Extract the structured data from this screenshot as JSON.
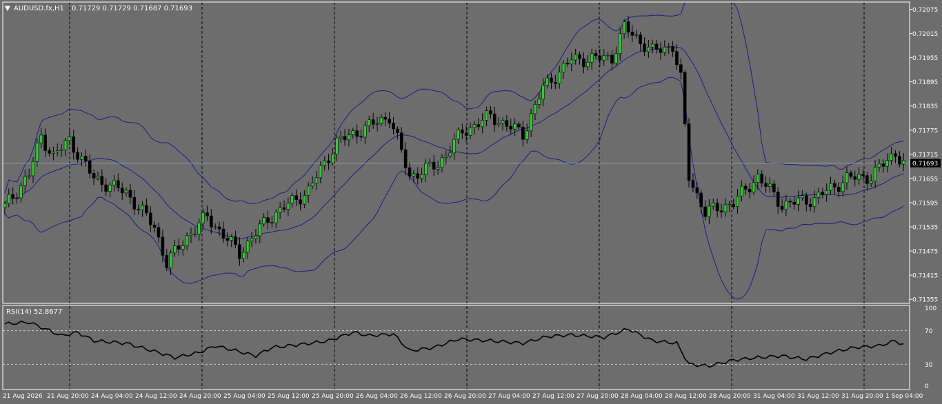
{
  "colors": {
    "background": "#6d6d6d",
    "frame": "#ffffff",
    "grid": "#000000",
    "bull_body": "#27d327",
    "bear_body": "#000000",
    "wick": "#000000",
    "bands": "#1a1a8c",
    "rsi_line": "#000000",
    "current_price_line": "#8fa3b8",
    "price_box_bg": "#000000",
    "price_box_text": "#ffffff"
  },
  "header": {
    "symbol_tf": "AUDUSD.fx,H1",
    "ohlc": "0.71729 0.71729 0.71687 0.71693",
    "dropdown_icon": "triangle-down-icon"
  },
  "rsi_header": {
    "label": "RSI(14) 52.8677"
  },
  "chart_data": [
    {
      "type": "candlestick",
      "symbol": "AUDUSD.fx",
      "timeframe": "H1",
      "y_ticks": [
        "0.72075",
        "0.72015",
        "0.71955",
        "0.71895",
        "0.71835",
        "0.71775",
        "0.71715",
        "0.71655",
        "0.71595",
        "0.71535",
        "0.71475",
        "0.71415",
        "0.71355"
      ],
      "ylim": [
        0.71345,
        0.72093
      ],
      "current_price": "0.71693",
      "grid": "vertical dashed at date ticks",
      "x_labels": [
        "21 Aug 2026",
        "21 Aug 20:00",
        "24 Aug 04:00",
        "24 Aug 12:00",
        "24 Aug 20:00",
        "25 Aug 04:00",
        "25 Aug 12:00",
        "25 Aug 20:00",
        "26 Aug 04:00",
        "26 Aug 12:00",
        "26 Aug 20:00",
        "27 Aug 04:00",
        "27 Aug 12:00",
        "27 Aug 20:00",
        "28 Aug 04:00",
        "28 Aug 12:00",
        "28 Aug 20:00",
        "31 Aug 04:00",
        "31 Aug 12:00",
        "31 Aug 20:00",
        "1 Sep 04:00"
      ],
      "ohlc_anchor_points": [
        {
          "i": 0,
          "close": 0.71585
        },
        {
          "i": 6,
          "close": 0.71665
        },
        {
          "i": 9,
          "close": 0.7176
        },
        {
          "i": 12,
          "close": 0.7171
        },
        {
          "i": 16,
          "close": 0.7175
        },
        {
          "i": 22,
          "close": 0.71655
        },
        {
          "i": 30,
          "close": 0.7162
        },
        {
          "i": 37,
          "close": 0.71535
        },
        {
          "i": 40,
          "close": 0.71445
        },
        {
          "i": 45,
          "close": 0.7151
        },
        {
          "i": 50,
          "close": 0.7156
        },
        {
          "i": 58,
          "close": 0.7147
        },
        {
          "i": 65,
          "close": 0.71555
        },
        {
          "i": 75,
          "close": 0.71625
        },
        {
          "i": 82,
          "close": 0.71745
        },
        {
          "i": 89,
          "close": 0.7178
        },
        {
          "i": 95,
          "close": 0.7181
        },
        {
          "i": 100,
          "close": 0.7166
        },
        {
          "i": 107,
          "close": 0.7169
        },
        {
          "i": 113,
          "close": 0.7177
        },
        {
          "i": 120,
          "close": 0.7181
        },
        {
          "i": 128,
          "close": 0.71765
        },
        {
          "i": 133,
          "close": 0.7188
        },
        {
          "i": 140,
          "close": 0.7195
        },
        {
          "i": 150,
          "close": 0.71955
        },
        {
          "i": 153,
          "close": 0.7203
        },
        {
          "i": 160,
          "close": 0.7197
        },
        {
          "i": 165,
          "close": 0.71985
        },
        {
          "i": 167,
          "close": 0.719
        },
        {
          "i": 169,
          "close": 0.7166
        },
        {
          "i": 173,
          "close": 0.7157
        },
        {
          "i": 180,
          "close": 0.71595
        },
        {
          "i": 186,
          "close": 0.7166
        },
        {
          "i": 192,
          "close": 0.7159
        },
        {
          "i": 200,
          "close": 0.71605
        },
        {
          "i": 208,
          "close": 0.71655
        },
        {
          "i": 214,
          "close": 0.7166
        },
        {
          "i": 220,
          "close": 0.7172
        },
        {
          "i": 222,
          "close": 0.71693
        }
      ],
      "bollinger_period_visible": true
    },
    {
      "type": "line",
      "name": "RSI(14) 52.8677",
      "ylim": [
        0,
        100
      ],
      "y_ticks": [
        "100",
        "70",
        "30",
        "0"
      ],
      "levels": [
        70,
        30
      ],
      "rsi_anchor_points": [
        {
          "i": 0,
          "v": 78
        },
        {
          "i": 6,
          "v": 80
        },
        {
          "i": 9,
          "v": 74
        },
        {
          "i": 14,
          "v": 64
        },
        {
          "i": 18,
          "v": 68
        },
        {
          "i": 22,
          "v": 58
        },
        {
          "i": 30,
          "v": 55
        },
        {
          "i": 38,
          "v": 44
        },
        {
          "i": 42,
          "v": 38
        },
        {
          "i": 48,
          "v": 44
        },
        {
          "i": 52,
          "v": 52
        },
        {
          "i": 58,
          "v": 45
        },
        {
          "i": 62,
          "v": 40
        },
        {
          "i": 66,
          "v": 50
        },
        {
          "i": 74,
          "v": 54
        },
        {
          "i": 80,
          "v": 58
        },
        {
          "i": 86,
          "v": 68
        },
        {
          "i": 90,
          "v": 64
        },
        {
          "i": 96,
          "v": 66
        },
        {
          "i": 100,
          "v": 46
        },
        {
          "i": 106,
          "v": 50
        },
        {
          "i": 112,
          "v": 60
        },
        {
          "i": 120,
          "v": 58
        },
        {
          "i": 128,
          "v": 55
        },
        {
          "i": 134,
          "v": 63
        },
        {
          "i": 140,
          "v": 65
        },
        {
          "i": 148,
          "v": 62
        },
        {
          "i": 154,
          "v": 72
        },
        {
          "i": 160,
          "v": 58
        },
        {
          "i": 166,
          "v": 55
        },
        {
          "i": 169,
          "v": 30
        },
        {
          "i": 174,
          "v": 28
        },
        {
          "i": 180,
          "v": 35
        },
        {
          "i": 186,
          "v": 38
        },
        {
          "i": 192,
          "v": 40
        },
        {
          "i": 198,
          "v": 36
        },
        {
          "i": 204,
          "v": 44
        },
        {
          "i": 210,
          "v": 50
        },
        {
          "i": 216,
          "v": 52
        },
        {
          "i": 220,
          "v": 58
        },
        {
          "i": 222,
          "v": 52.87
        }
      ]
    }
  ]
}
